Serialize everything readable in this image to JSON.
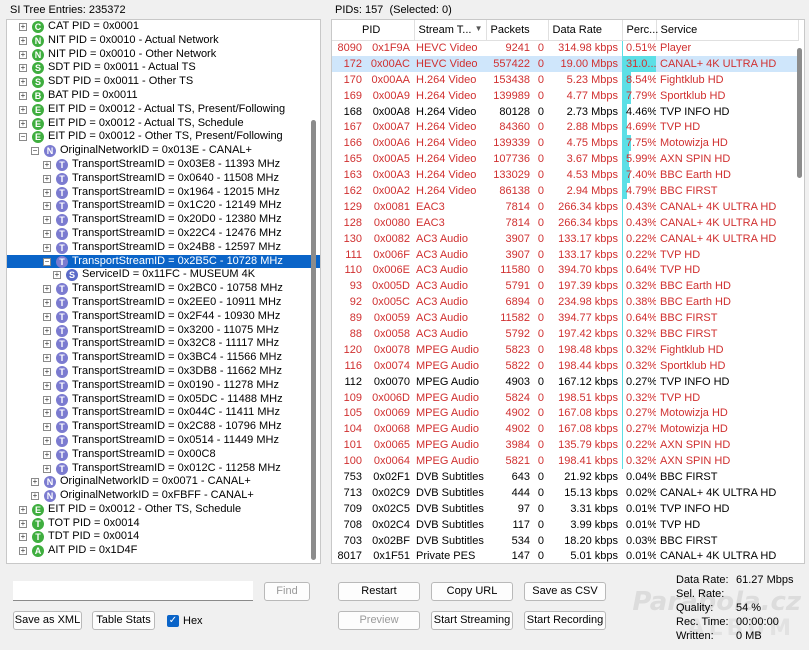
{
  "tree_header": "SI Tree Entries: 235372",
  "pid_header": "PIDs: 157",
  "selected_header": "(Selected: 0)",
  "tree": [
    {
      "toggle": "+",
      "icon": "C",
      "color": "g",
      "label": "CAT PID = 0x0001",
      "level": 0
    },
    {
      "toggle": "+",
      "icon": "N",
      "color": "g",
      "label": "NIT PID = 0x0010 - Actual Network",
      "level": 0
    },
    {
      "toggle": "+",
      "icon": "N",
      "color": "g",
      "label": "NIT PID = 0x0010 - Other Network",
      "level": 0
    },
    {
      "toggle": "+",
      "icon": "S",
      "color": "g",
      "label": "SDT PID = 0x0011 - Actual TS",
      "level": 0
    },
    {
      "toggle": "+",
      "icon": "S",
      "color": "g",
      "label": "SDT PID = 0x0011 - Other TS",
      "level": 0
    },
    {
      "toggle": "+",
      "icon": "B",
      "color": "g",
      "label": "BAT PID = 0x0011",
      "level": 0
    },
    {
      "toggle": "+",
      "icon": "E",
      "color": "g",
      "label": "EIT PID = 0x0012 - Actual TS, Present/Following",
      "level": 0
    },
    {
      "toggle": "+",
      "icon": "E",
      "color": "g",
      "label": "EIT PID = 0x0012 - Actual TS, Schedule",
      "level": 0
    },
    {
      "toggle": "−",
      "icon": "E",
      "color": "g",
      "label": "EIT PID = 0x0012 - Other TS, Present/Following",
      "level": 0
    },
    {
      "toggle": "−",
      "icon": "N",
      "color": "p",
      "label": "OriginalNetworkID = 0x013E - CANAL+",
      "level": 1
    },
    {
      "toggle": "+",
      "icon": "T",
      "color": "p",
      "label": "TransportStreamID = 0x03E8 - 11393 MHz",
      "level": 2
    },
    {
      "toggle": "+",
      "icon": "T",
      "color": "p",
      "label": "TransportStreamID = 0x0640 - 11508 MHz",
      "level": 2
    },
    {
      "toggle": "+",
      "icon": "T",
      "color": "p",
      "label": "TransportStreamID = 0x1964 - 12015 MHz",
      "level": 2
    },
    {
      "toggle": "+",
      "icon": "T",
      "color": "p",
      "label": "TransportStreamID = 0x1C20 - 12149 MHz",
      "level": 2
    },
    {
      "toggle": "+",
      "icon": "T",
      "color": "p",
      "label": "TransportStreamID = 0x20D0 - 12380 MHz",
      "level": 2
    },
    {
      "toggle": "+",
      "icon": "T",
      "color": "p",
      "label": "TransportStreamID = 0x22C4 - 12476 MHz",
      "level": 2
    },
    {
      "toggle": "+",
      "icon": "T",
      "color": "p",
      "label": "TransportStreamID = 0x24B8 - 12597 MHz",
      "level": 2
    },
    {
      "toggle": "−",
      "icon": "T",
      "color": "p",
      "label": "TransportStreamID = 0x2B5C - 10728 MHz",
      "level": 2,
      "selected": true
    },
    {
      "toggle": "+",
      "icon": "S",
      "color": "b",
      "label": "ServiceID = 0x11FC - MUSEUM 4K",
      "level": 3
    },
    {
      "toggle": "+",
      "icon": "T",
      "color": "p",
      "label": "TransportStreamID = 0x2BC0 - 10758 MHz",
      "level": 2
    },
    {
      "toggle": "+",
      "icon": "T",
      "color": "p",
      "label": "TransportStreamID = 0x2EE0 - 10911 MHz",
      "level": 2
    },
    {
      "toggle": "+",
      "icon": "T",
      "color": "p",
      "label": "TransportStreamID = 0x2F44 - 10930 MHz",
      "level": 2
    },
    {
      "toggle": "+",
      "icon": "T",
      "color": "p",
      "label": "TransportStreamID = 0x3200 - 11075 MHz",
      "level": 2
    },
    {
      "toggle": "+",
      "icon": "T",
      "color": "p",
      "label": "TransportStreamID = 0x32C8 - 11117 MHz",
      "level": 2
    },
    {
      "toggle": "+",
      "icon": "T",
      "color": "p",
      "label": "TransportStreamID = 0x3BC4 - 11566 MHz",
      "level": 2
    },
    {
      "toggle": "+",
      "icon": "T",
      "color": "p",
      "label": "TransportStreamID = 0x3DB8 - 11662 MHz",
      "level": 2
    },
    {
      "toggle": "+",
      "icon": "T",
      "color": "p",
      "label": "TransportStreamID = 0x0190 - 11278 MHz",
      "level": 2
    },
    {
      "toggle": "+",
      "icon": "T",
      "color": "p",
      "label": "TransportStreamID = 0x05DC - 11488 MHz",
      "level": 2
    },
    {
      "toggle": "+",
      "icon": "T",
      "color": "p",
      "label": "TransportStreamID = 0x044C - 11411 MHz",
      "level": 2
    },
    {
      "toggle": "+",
      "icon": "T",
      "color": "p",
      "label": "TransportStreamID = 0x2C88 - 10796 MHz",
      "level": 2
    },
    {
      "toggle": "+",
      "icon": "T",
      "color": "p",
      "label": "TransportStreamID = 0x0514 - 11449 MHz",
      "level": 2
    },
    {
      "toggle": "+",
      "icon": "T",
      "color": "p",
      "label": "TransportStreamID = 0x00C8",
      "level": 2
    },
    {
      "toggle": "+",
      "icon": "T",
      "color": "p",
      "label": "TransportStreamID = 0x012C - 11258 MHz",
      "level": 2
    },
    {
      "toggle": "+",
      "icon": "N",
      "color": "p",
      "label": "OriginalNetworkID = 0x0071 - CANAL+",
      "level": 1
    },
    {
      "toggle": "+",
      "icon": "N",
      "color": "p",
      "label": "OriginalNetworkID = 0xFBFF - CANAL+",
      "level": 1
    },
    {
      "toggle": "+",
      "icon": "E",
      "color": "g",
      "label": "EIT PID = 0x0012 - Other TS, Schedule",
      "level": 0
    },
    {
      "toggle": "+",
      "icon": "T",
      "color": "g",
      "label": "TOT PID = 0x0014",
      "level": 0
    },
    {
      "toggle": "+",
      "icon": "T",
      "color": "g",
      "label": "TDT PID = 0x0014",
      "level": 0
    },
    {
      "toggle": "+",
      "icon": "A",
      "color": "g",
      "label": "AIT PID = 0x1D4F",
      "level": 0
    }
  ],
  "columns": [
    "PID",
    "Stream T...",
    "Packets",
    "Data Rate",
    "Perc...",
    "Service"
  ],
  "sort_indicator": "▼",
  "pids": [
    {
      "dec": "8090",
      "hex": "0x1F9A",
      "type": "HEVC Video",
      "packets": "9241",
      "cc": "0",
      "rate": "314.98 kbps",
      "perc": "0.51%",
      "pct": 0.51,
      "service": "Player",
      "red": true
    },
    {
      "dec": "172",
      "hex": "0x00AC",
      "type": "HEVC Video",
      "packets": "557422",
      "cc": "0",
      "rate": "19.00 Mbps",
      "perc": "31.0...",
      "pct": 31.0,
      "service": "CANAL+ 4K ULTRA HD",
      "red": true,
      "hl": true
    },
    {
      "dec": "170",
      "hex": "0x00AA",
      "type": "H.264 Video",
      "packets": "153438",
      "cc": "0",
      "rate": "5.23 Mbps",
      "perc": "8.54%",
      "pct": 8.54,
      "service": "Fightklub HD",
      "red": true
    },
    {
      "dec": "169",
      "hex": "0x00A9",
      "type": "H.264 Video",
      "packets": "139989",
      "cc": "0",
      "rate": "4.77 Mbps",
      "perc": "7.79%",
      "pct": 7.79,
      "service": "Sportklub HD",
      "red": true
    },
    {
      "dec": "168",
      "hex": "0x00A8",
      "type": "H.264 Video",
      "packets": "80128",
      "cc": "0",
      "rate": "2.73 Mbps",
      "perc": "4.46%",
      "pct": 4.46,
      "service": "TVP INFO HD",
      "red": false
    },
    {
      "dec": "167",
      "hex": "0x00A7",
      "type": "H.264 Video",
      "packets": "84360",
      "cc": "0",
      "rate": "2.88 Mbps",
      "perc": "4.69%",
      "pct": 4.69,
      "service": "TVP HD",
      "red": true
    },
    {
      "dec": "166",
      "hex": "0x00A6",
      "type": "H.264 Video",
      "packets": "139339",
      "cc": "0",
      "rate": "4.75 Mbps",
      "perc": "7.75%",
      "pct": 7.75,
      "service": "Motowizja HD",
      "red": true
    },
    {
      "dec": "165",
      "hex": "0x00A5",
      "type": "H.264 Video",
      "packets": "107736",
      "cc": "0",
      "rate": "3.67 Mbps",
      "perc": "5.99%",
      "pct": 5.99,
      "service": "AXN SPIN HD",
      "red": true
    },
    {
      "dec": "163",
      "hex": "0x00A3",
      "type": "H.264 Video",
      "packets": "133029",
      "cc": "0",
      "rate": "4.53 Mbps",
      "perc": "7.40%",
      "pct": 7.4,
      "service": "BBC Earth HD",
      "red": true
    },
    {
      "dec": "162",
      "hex": "0x00A2",
      "type": "H.264 Video",
      "packets": "86138",
      "cc": "0",
      "rate": "2.94 Mbps",
      "perc": "4.79%",
      "pct": 4.79,
      "service": "BBC FIRST",
      "red": true
    },
    {
      "dec": "129",
      "hex": "0x0081",
      "type": "EAC3",
      "packets": "7814",
      "cc": "0",
      "rate": "266.34 kbps",
      "perc": "0.43%",
      "pct": 0.43,
      "service": "CANAL+ 4K ULTRA HD",
      "red": true
    },
    {
      "dec": "128",
      "hex": "0x0080",
      "type": "EAC3",
      "packets": "7814",
      "cc": "0",
      "rate": "266.34 kbps",
      "perc": "0.43%",
      "pct": 0.43,
      "service": "CANAL+ 4K ULTRA HD",
      "red": true
    },
    {
      "dec": "130",
      "hex": "0x0082",
      "type": "AC3 Audio",
      "packets": "3907",
      "cc": "0",
      "rate": "133.17 kbps",
      "perc": "0.22%",
      "pct": 0.22,
      "service": "CANAL+ 4K ULTRA HD",
      "red": true
    },
    {
      "dec": "111",
      "hex": "0x006F",
      "type": "AC3 Audio",
      "packets": "3907",
      "cc": "0",
      "rate": "133.17 kbps",
      "perc": "0.22%",
      "pct": 0.22,
      "service": "TVP HD",
      "red": true
    },
    {
      "dec": "110",
      "hex": "0x006E",
      "type": "AC3 Audio",
      "packets": "11580",
      "cc": "0",
      "rate": "394.70 kbps",
      "perc": "0.64%",
      "pct": 0.64,
      "service": "TVP HD",
      "red": true
    },
    {
      "dec": "93",
      "hex": "0x005D",
      "type": "AC3 Audio",
      "packets": "5791",
      "cc": "0",
      "rate": "197.39 kbps",
      "perc": "0.32%",
      "pct": 0.32,
      "service": "BBC Earth HD",
      "red": true
    },
    {
      "dec": "92",
      "hex": "0x005C",
      "type": "AC3 Audio",
      "packets": "6894",
      "cc": "0",
      "rate": "234.98 kbps",
      "perc": "0.38%",
      "pct": 0.38,
      "service": "BBC Earth HD",
      "red": true
    },
    {
      "dec": "89",
      "hex": "0x0059",
      "type": "AC3 Audio",
      "packets": "11582",
      "cc": "0",
      "rate": "394.77 kbps",
      "perc": "0.64%",
      "pct": 0.64,
      "service": "BBC FIRST",
      "red": true
    },
    {
      "dec": "88",
      "hex": "0x0058",
      "type": "AC3 Audio",
      "packets": "5792",
      "cc": "0",
      "rate": "197.42 kbps",
      "perc": "0.32%",
      "pct": 0.32,
      "service": "BBC FIRST",
      "red": true
    },
    {
      "dec": "120",
      "hex": "0x0078",
      "type": "MPEG Audio",
      "packets": "5823",
      "cc": "0",
      "rate": "198.48 kbps",
      "perc": "0.32%",
      "pct": 0.32,
      "service": "Fightklub HD",
      "red": true
    },
    {
      "dec": "116",
      "hex": "0x0074",
      "type": "MPEG Audio",
      "packets": "5822",
      "cc": "0",
      "rate": "198.44 kbps",
      "perc": "0.32%",
      "pct": 0.32,
      "service": "Sportklub HD",
      "red": true
    },
    {
      "dec": "112",
      "hex": "0x0070",
      "type": "MPEG Audio",
      "packets": "4903",
      "cc": "0",
      "rate": "167.12 kbps",
      "perc": "0.27%",
      "pct": 0.27,
      "service": "TVP INFO HD",
      "red": false
    },
    {
      "dec": "109",
      "hex": "0x006D",
      "type": "MPEG Audio",
      "packets": "5824",
      "cc": "0",
      "rate": "198.51 kbps",
      "perc": "0.32%",
      "pct": 0.32,
      "service": "TVP HD",
      "red": true
    },
    {
      "dec": "105",
      "hex": "0x0069",
      "type": "MPEG Audio",
      "packets": "4902",
      "cc": "0",
      "rate": "167.08 kbps",
      "perc": "0.27%",
      "pct": 0.27,
      "service": "Motowizja HD",
      "red": true
    },
    {
      "dec": "104",
      "hex": "0x0068",
      "type": "MPEG Audio",
      "packets": "4902",
      "cc": "0",
      "rate": "167.08 kbps",
      "perc": "0.27%",
      "pct": 0.27,
      "service": "Motowizja HD",
      "red": true
    },
    {
      "dec": "101",
      "hex": "0x0065",
      "type": "MPEG Audio",
      "packets": "3984",
      "cc": "0",
      "rate": "135.79 kbps",
      "perc": "0.22%",
      "pct": 0.22,
      "service": "AXN SPIN HD",
      "red": true
    },
    {
      "dec": "100",
      "hex": "0x0064",
      "type": "MPEG Audio",
      "packets": "5821",
      "cc": "0",
      "rate": "198.41 kbps",
      "perc": "0.32%",
      "pct": 0.32,
      "service": "AXN SPIN HD",
      "red": true
    },
    {
      "dec": "753",
      "hex": "0x02F1",
      "type": "DVB Subtitles",
      "packets": "643",
      "cc": "0",
      "rate": "21.92 kbps",
      "perc": "0.04%",
      "pct": 0.04,
      "service": "BBC FIRST",
      "red": false
    },
    {
      "dec": "713",
      "hex": "0x02C9",
      "type": "DVB Subtitles",
      "packets": "444",
      "cc": "0",
      "rate": "15.13 kbps",
      "perc": "0.02%",
      "pct": 0.02,
      "service": "CANAL+ 4K ULTRA HD",
      "red": false
    },
    {
      "dec": "709",
      "hex": "0x02C5",
      "type": "DVB Subtitles",
      "packets": "97",
      "cc": "0",
      "rate": "3.31 kbps",
      "perc": "0.01%",
      "pct": 0.01,
      "service": "TVP INFO HD",
      "red": false
    },
    {
      "dec": "708",
      "hex": "0x02C4",
      "type": "DVB Subtitles",
      "packets": "117",
      "cc": "0",
      "rate": "3.99 kbps",
      "perc": "0.01%",
      "pct": 0.01,
      "service": "TVP HD",
      "red": false
    },
    {
      "dec": "703",
      "hex": "0x02BF",
      "type": "DVB Subtitles",
      "packets": "534",
      "cc": "0",
      "rate": "18.20 kbps",
      "perc": "0.03%",
      "pct": 0.03,
      "service": "BBC FIRST",
      "red": false
    },
    {
      "dec": "8017",
      "hex": "0x1F51",
      "type": "Private PES",
      "packets": "147",
      "cc": "0",
      "rate": "5.01 kbps",
      "perc": "0.01%",
      "pct": 0.01,
      "service": "CANAL+ 4K ULTRA HD",
      "red": false
    }
  ],
  "buttons": {
    "find": "Find",
    "save_xml": "Save as XML",
    "table_stats": "Table Stats",
    "hex": "Hex",
    "restart": "Restart",
    "copy_url": "Copy URL",
    "save_csv": "Save as CSV",
    "preview": "Preview",
    "start_streaming": "Start Streaming",
    "start_recording": "Start Recording"
  },
  "stats": {
    "data_rate_label": "Data Rate:",
    "data_rate": "61.27 Mbps",
    "sel_rate_label": "Sel. Rate:",
    "sel_rate": "",
    "quality_label": "Quality:",
    "quality": "54 %",
    "rec_time_label": "Rec. Time:",
    "rec_time": "00:00:00",
    "written_label": "Written:",
    "written": "0 MB"
  },
  "watermark": {
    "line1": "Parabola.cz",
    "line2": "ALBUM"
  },
  "colors": {
    "accent": "#0a64c8",
    "error_text": "#d03030",
    "pct_bar": "#5cdfe6",
    "highlight_row": "#cfe6fb"
  }
}
